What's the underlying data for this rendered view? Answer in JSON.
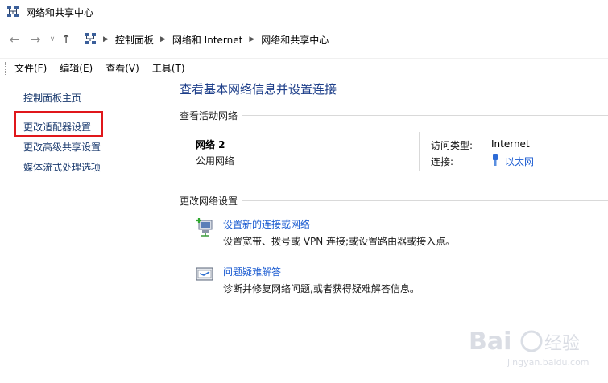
{
  "window": {
    "title": "网络和共享中心"
  },
  "address": {
    "crumbs": [
      "控制面板",
      "网络和 Internet",
      "网络和共享中心"
    ]
  },
  "menu": {
    "items": [
      "文件(F)",
      "编辑(E)",
      "查看(V)",
      "工具(T)"
    ]
  },
  "sidebar": {
    "items": [
      {
        "label": "控制面板主页"
      },
      {
        "label": "更改适配器设置"
      },
      {
        "label": "更改高级共享设置"
      },
      {
        "label": "媒体流式处理选项"
      }
    ]
  },
  "main": {
    "title": "查看基本网络信息并设置连接",
    "active_networks_label": "查看活动网络",
    "network": {
      "name": "网络 2",
      "kind": "公用网络",
      "access_type_label": "访问类型:",
      "access_type_value": "Internet",
      "connection_label": "连接:",
      "connection_value": "以太网"
    },
    "change_settings_label": "更改网络设置",
    "tasks": [
      {
        "link": "设置新的连接或网络",
        "desc": "设置宽带、拨号或 VPN 连接;或设置路由器或接入点。"
      },
      {
        "link": "问题疑难解答",
        "desc": "诊断并修复网络问题,或者获得疑难解答信息。"
      }
    ]
  },
  "watermark": {
    "brand": "Bai",
    "brand_tail": "经验",
    "url": "jingyan.baidu.com"
  },
  "colors": {
    "link": "#1a5bd1",
    "title": "#1e3f8a",
    "sidebar_link": "#1a3a6e",
    "highlight": "#e0171b"
  }
}
